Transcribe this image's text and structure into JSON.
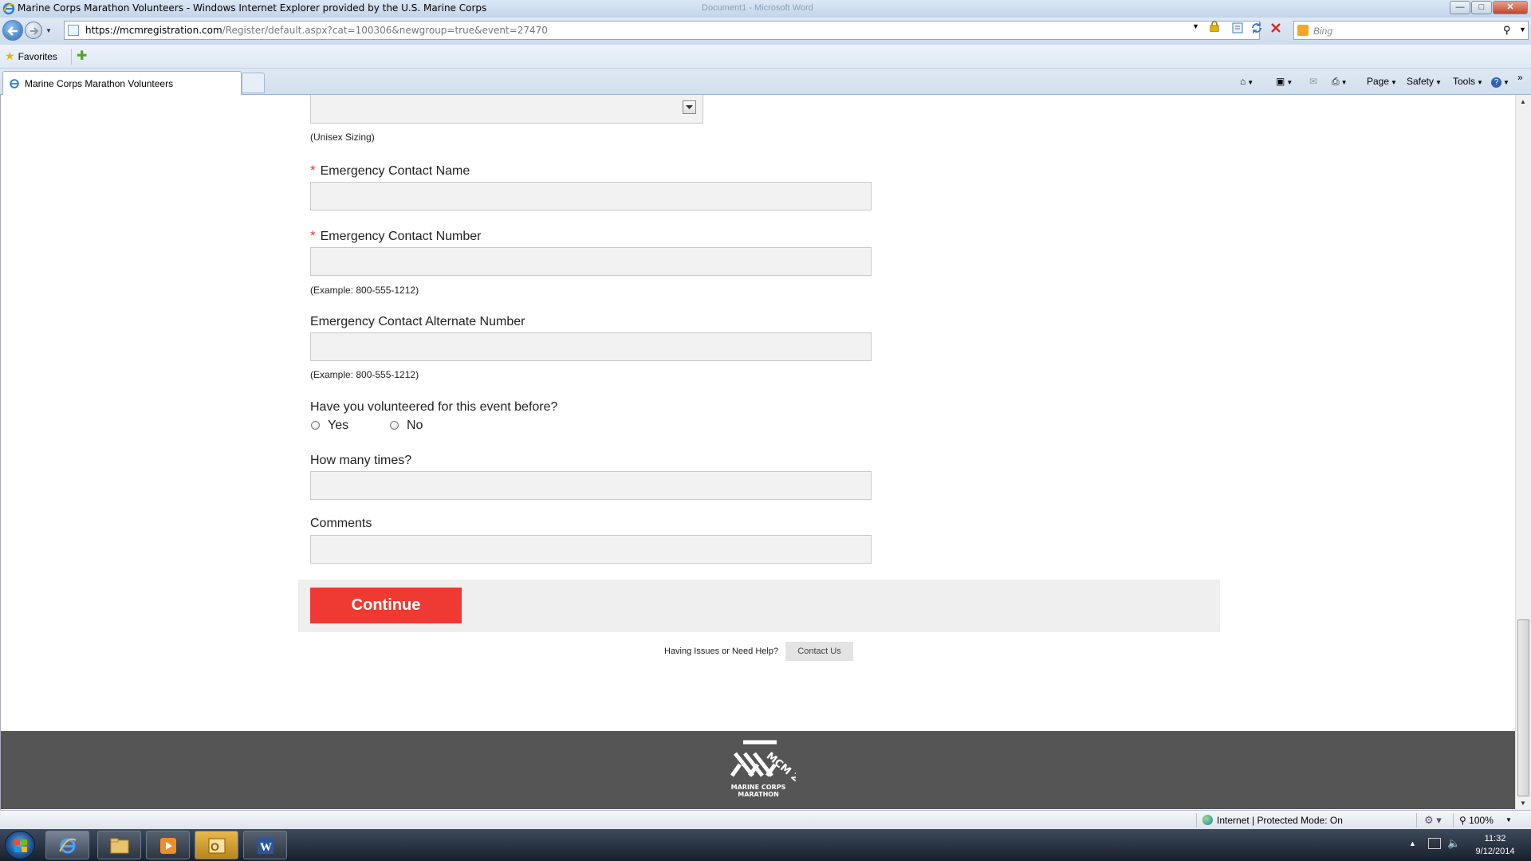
{
  "browser": {
    "window_title": "Marine Corps Marathon Volunteers - Windows Internet Explorer provided by the U.S. Marine Corps",
    "ghost_title": "Document1 - Microsoft Word",
    "url_host": "https://mcmregistration.com",
    "url_path": "/Register/default.aspx?cat=100306&newgroup=true&event=27470",
    "search_placeholder": "Bing",
    "favorites_label": "Favorites",
    "tab_label": "Marine Corps Marathon Volunteers",
    "commands": {
      "page": "Page",
      "safety": "Safety",
      "tools": "Tools"
    },
    "window_buttons": {
      "minimize": "—",
      "maximize": "□",
      "close": "✕"
    }
  },
  "form": {
    "shirt_hint": "(Unisex Sizing)",
    "emergency_name_label": "Emergency Contact Name",
    "emergency_number_label": "Emergency Contact Number",
    "emergency_number_hint": "(Example: 800-555-1212)",
    "emergency_alt_label": "Emergency Contact Alternate Number",
    "emergency_alt_hint": "(Example: 800-555-1212)",
    "volunteered_question": "Have you volunteered for this event before?",
    "yes_label": "Yes",
    "no_label": "No",
    "how_many_label": "How many times?",
    "comments_label": "Comments",
    "required_mark": "*",
    "continue_label": "Continue",
    "help_text": "Having Issues or Need Help?",
    "contact_label": "Contact Us"
  },
  "footer": {
    "logo_text": "MCM 26.2",
    "logo_caption": "MARINE CORPS MARATHON"
  },
  "status": {
    "zone_text": "Internet | Protected Mode: On",
    "zoom": "100%"
  },
  "taskbar": {
    "time": "11:32",
    "date": "9/12/2014"
  },
  "colors": {
    "accent_red": "#ee3a33",
    "footer_gray": "#555555",
    "input_bg": "#f2f2f2"
  }
}
